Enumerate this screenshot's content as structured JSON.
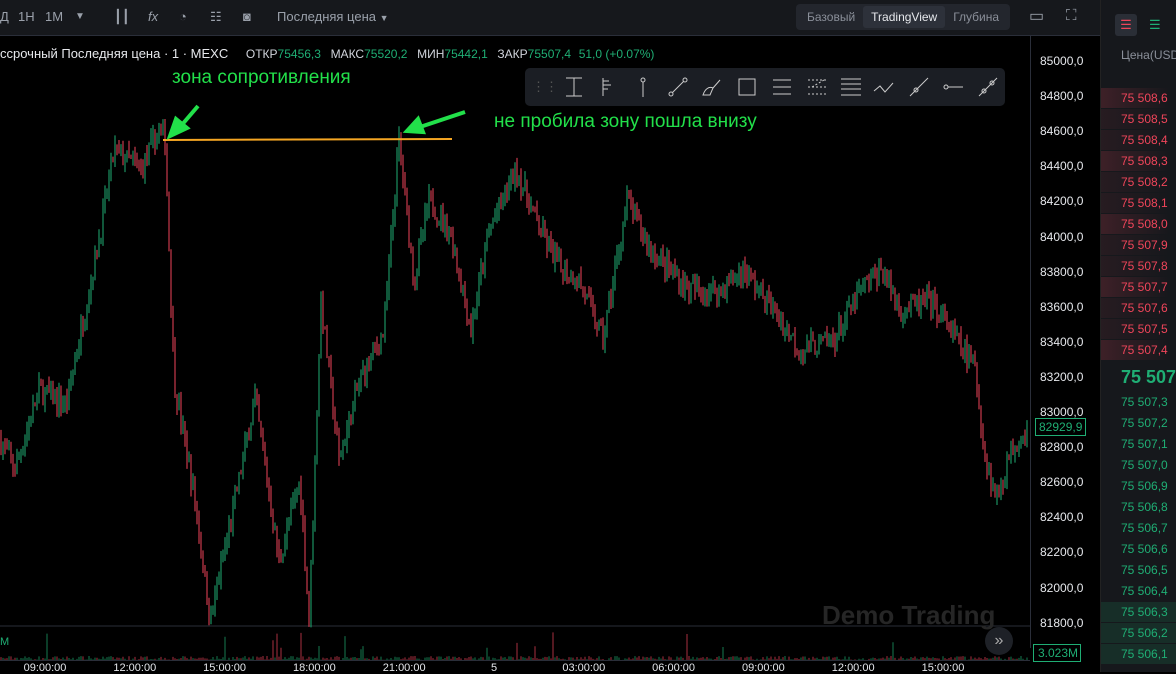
{
  "toolbar": {
    "intervals": [
      "Д",
      "1H",
      "1M"
    ],
    "price_type": "Последняя цена",
    "views": [
      "Базовый",
      "TradingView",
      "Глубина"
    ],
    "active_view": "TradingView"
  },
  "legend": {
    "symbol": "ссрочный Последняя цена · 1 · MEXC",
    "open_label": "ОТКР",
    "open": "75456,3",
    "high_label": "МАКС",
    "high": "75520,2",
    "low_label": "МИН",
    "low": "75442,1",
    "close_label": "ЗАКР",
    "close": "75507,4",
    "change": "51,0 (+0.07%)"
  },
  "annotations": {
    "resistance": "зона сопротивления",
    "note": "не пробила зону пошла внизу"
  },
  "watermark": "Demo Trading",
  "volume_label": "3.023M",
  "volume_axis_letter": "M",
  "current_price_label": "82929,9",
  "price_axis": [
    "85000,0",
    "84800,0",
    "84600,0",
    "84400,0",
    "84200,0",
    "84000,0",
    "83800,0",
    "83600,0",
    "83400,0",
    "83200,0",
    "83000,0",
    "82800,0",
    "82600,0",
    "82400,0",
    "82200,0",
    "82000,0",
    "81800,0"
  ],
  "time_axis": [
    "09:00:00",
    "12:00:00",
    "15:00:00",
    "18:00:00",
    "21:00:00",
    "5",
    "03:00:00",
    "06:00:00",
    "09:00:00",
    "12:00:00",
    "15:00:00"
  ],
  "orderbook": {
    "header": "Цена(USDT",
    "asks": [
      "75 508,6",
      "75 508,5",
      "75 508,4",
      "75 508,3",
      "75 508,2",
      "75 508,1",
      "75 508,0",
      "75 507,9",
      "75 507,8",
      "75 507,7",
      "75 507,6",
      "75 507,5",
      "75 507,4"
    ],
    "mid": "75 507",
    "bids": [
      "75 507,3",
      "75 507,2",
      "75 507,1",
      "75 507,0",
      "75 506,9",
      "75 506,8",
      "75 506,7",
      "75 506,6",
      "75 506,5",
      "75 506,4",
      "75 506,3",
      "75 506,2",
      "75 506,1"
    ]
  },
  "colors": {
    "up": "#1fae74",
    "down": "#f0455a",
    "annotation": "#22e04a",
    "resistance_line": "#f5a623"
  },
  "chart_data": {
    "type": "candlestick",
    "ylim": [
      81800,
      85000
    ],
    "resistance_level": 84560,
    "path_hours_price": [
      [
        7.5,
        82850
      ],
      [
        8,
        82680
      ],
      [
        8.8,
        83130
      ],
      [
        9.7,
        83050
      ],
      [
        10.2,
        83470
      ],
      [
        10.8,
        83990
      ],
      [
        11.3,
        84500
      ],
      [
        12.2,
        84390
      ],
      [
        12.8,
        84610
      ],
      [
        13,
        84560
      ],
      [
        13.3,
        83190
      ],
      [
        14,
        82500
      ],
      [
        14.5,
        81820
      ],
      [
        15.2,
        82390
      ],
      [
        16,
        83080
      ],
      [
        16.8,
        82160
      ],
      [
        17.5,
        82620
      ],
      [
        17.8,
        81820
      ],
      [
        18.2,
        83640
      ],
      [
        18.8,
        82730
      ],
      [
        19.5,
        83190
      ],
      [
        20.3,
        83470
      ],
      [
        20.8,
        84560
      ],
      [
        21.3,
        83760
      ],
      [
        21.8,
        84210
      ],
      [
        22.5,
        84040
      ],
      [
        23.2,
        83470
      ],
      [
        23.8,
        84040
      ],
      [
        24.7,
        84390
      ],
      [
        25.5,
        84040
      ],
      [
        26.2,
        83820
      ],
      [
        26.8,
        83760
      ],
      [
        27.6,
        83420
      ],
      [
        28.4,
        84210
      ],
      [
        29.2,
        83930
      ],
      [
        30.5,
        83700
      ],
      [
        31.5,
        83700
      ],
      [
        32.3,
        83820
      ],
      [
        33.5,
        83530
      ],
      [
        34.2,
        83360
      ],
      [
        35.3,
        83420
      ],
      [
        36.2,
        83700
      ],
      [
        36.9,
        83820
      ],
      [
        37.5,
        83590
      ],
      [
        38.5,
        83640
      ],
      [
        39.2,
        83470
      ],
      [
        40,
        83250
      ],
      [
        40.3,
        82790
      ],
      [
        40.7,
        82510
      ],
      [
        41.2,
        82790
      ],
      [
        41.8,
        82930
      ]
    ]
  }
}
